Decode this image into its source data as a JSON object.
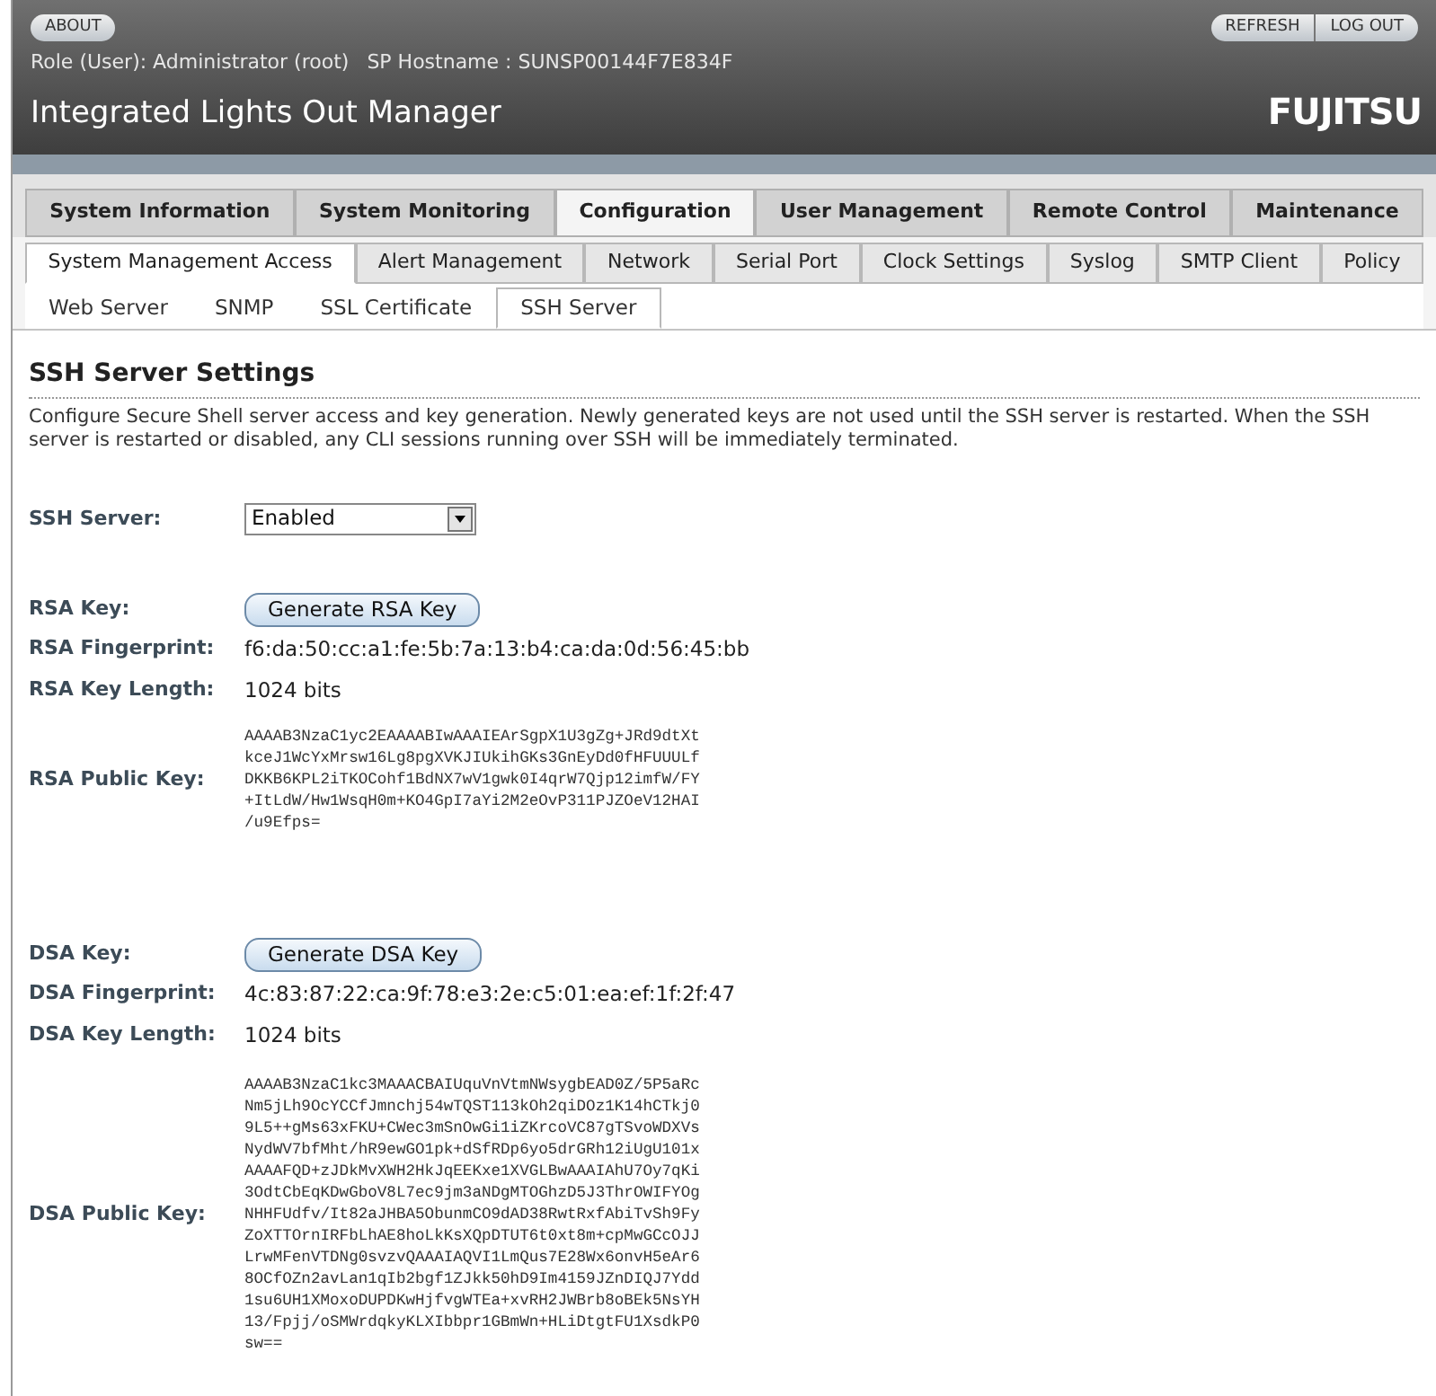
{
  "header": {
    "about": "ABOUT",
    "actions": [
      "REFRESH",
      "LOG OUT"
    ],
    "role": "Role (User): Administrator (root)",
    "hostname": "SP Hostname : SUNSP00144F7E834F",
    "title": "Integrated Lights Out Manager",
    "logo": "FUJITSU"
  },
  "main_tabs": [
    {
      "label": "System Information",
      "selected": false
    },
    {
      "label": "System Monitoring",
      "selected": false
    },
    {
      "label": "Configuration",
      "selected": true
    },
    {
      "label": "User Management",
      "selected": false
    },
    {
      "label": "Remote Control",
      "selected": false
    },
    {
      "label": "Maintenance",
      "selected": false
    }
  ],
  "sub_tabs": [
    {
      "label": "System Management Access",
      "selected": true
    },
    {
      "label": "Alert Management",
      "selected": false
    },
    {
      "label": "Network",
      "selected": false
    },
    {
      "label": "Serial Port",
      "selected": false
    },
    {
      "label": "Clock Settings",
      "selected": false
    },
    {
      "label": "Syslog",
      "selected": false
    },
    {
      "label": "SMTP Client",
      "selected": false
    },
    {
      "label": "Policy",
      "selected": false
    }
  ],
  "third_tabs": [
    {
      "label": "Web Server",
      "selected": false
    },
    {
      "label": "SNMP",
      "selected": false
    },
    {
      "label": "SSL Certificate",
      "selected": false
    },
    {
      "label": "SSH Server",
      "selected": true
    }
  ],
  "page": {
    "title": "SSH Server Settings",
    "description": "Configure Secure Shell server access and key generation. Newly generated keys are not used until the SSH server is restarted. When the SSH server is restarted or disabled, any CLI sessions running over SSH will be immediately terminated.",
    "ssh_server": {
      "label": "SSH Server:",
      "value": "Enabled"
    }
  },
  "keys": [
    {
      "key_label": "RSA Key:",
      "button": "Generate RSA Key",
      "fingerprint_label": "RSA Fingerprint:",
      "fingerprint": "f6:da:50:cc:a1:fe:5b:7a:13:b4:ca:da:0d:56:45:bb",
      "length_label": "RSA Key Length:",
      "length": "1024 bits",
      "public_key_label": "RSA Public Key:",
      "public_key": [
        "AAAAB3NzaC1yc2EAAAABIwAAAIEArSgpX1U3gZg+JRd9dtXt",
        "kceJ1WcYxMrsw16Lg8pgXVKJIUkihGKs3GnEyDd0fHFUUULf",
        "DKKB6KPL2iTKOCohf1BdNX7wV1gwk0I4qrW7Qjp12imfW/FY",
        "+ItLdW/Hw1WsqH0m+KO4GpI7aYi2M2eOvP311PJZOeV12HAI",
        "/u9Efps="
      ]
    },
    {
      "key_label": "DSA Key:",
      "button": "Generate DSA Key",
      "fingerprint_label": "DSA Fingerprint:",
      "fingerprint": "4c:83:87:22:ca:9f:78:e3:2e:c5:01:ea:ef:1f:2f:47",
      "length_label": "DSA Key Length:",
      "length": "1024 bits",
      "public_key_label": "DSA Public Key:",
      "public_key": [
        "AAAAB3NzaC1kc3MAAACBAIUquVnVtmNWsygbEAD0Z/5P5aRc",
        "Nm5jLh9OcYCCfJmnchj54wTQST113kOh2qiDOz1K14hCTkj0",
        "9L5++gMs63xFKU+CWec3mSnOwGi1iZKrcoVC87gTSvoWDXVs",
        "NydWV7bfMht/hR9ewGO1pk+dSfRDp6yo5drGRh12iUgU101x",
        "AAAAFQD+zJDkMvXWH2HkJqEEKxe1XVGLBwAAAIAhU7Oy7qKi",
        "3OdtCbEqKDwGboV8L7ec9jm3aNDgMTOGhzD5J3ThrOWIFYOg",
        "NHHFUdfv/It82aJHBA5ObunmCO9dAD38RwtRxfAbiTvSh9Fy",
        "ZoXTTOrnIRFbLhAE8hoLkKsXQpDTUT6t0xt8m+cpMwGCcOJJ",
        "LrwMFenVTDNg0svzvQAAAIAQVI1LmQus7E28Wx6onvH5eAr6",
        "8OCfOZn2avLan1qIb2bgf1ZJkk50hD9Im4159JZnDIQJ7Ydd",
        "1su6UH1XMoxoDUPDKwHjfvgWTEa+xvRH2JWBrb8oBEk5NsYH",
        "13/Fpjj/oSMWrdqkyKLXIbbpr1GBmWn+HLiDtgtFU1XsdkP0",
        "sw=="
      ]
    }
  ]
}
